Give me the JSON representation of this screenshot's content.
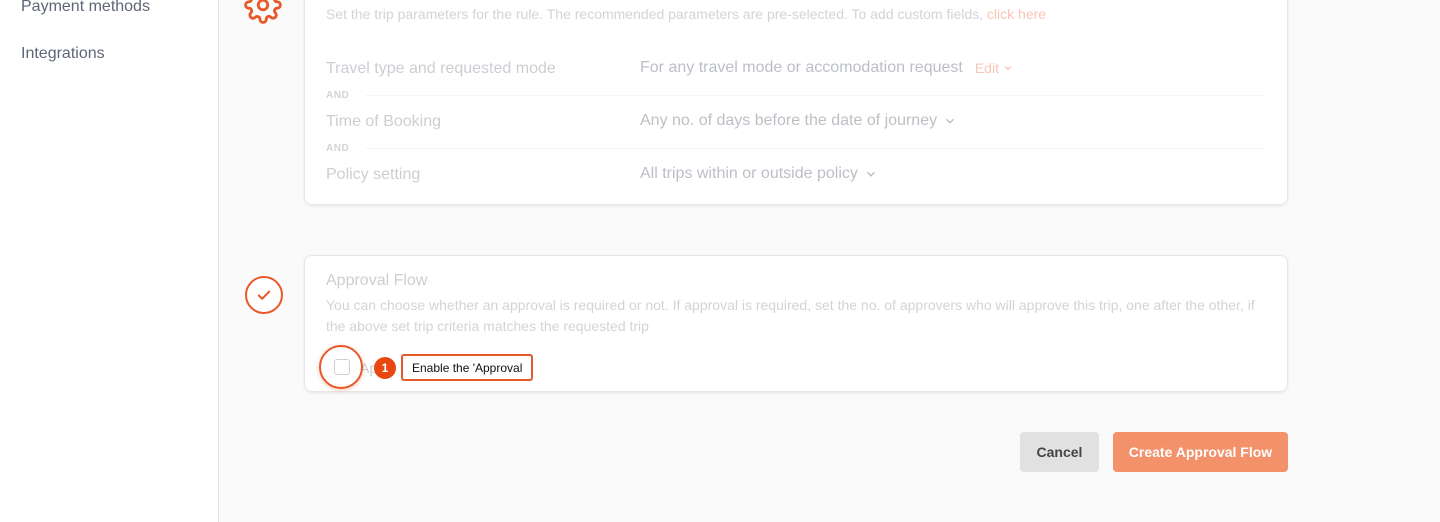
{
  "sidebar": {
    "items": [
      {
        "label": "Payment methods"
      },
      {
        "label": "Integrations"
      }
    ]
  },
  "trip_card": {
    "description": "Set the trip parameters for the rule. The recommended parameters are pre-selected. To add custom fields,",
    "link": "click here",
    "rows": [
      {
        "label": "Travel type and requested mode",
        "value": "For any travel mode or accomodation request",
        "edit": "Edit"
      },
      {
        "label": "Time of Booking",
        "value": "Any no. of days before the date of journey"
      },
      {
        "label": "Policy setting",
        "value": "All trips within or outside policy"
      }
    ],
    "connector": "AND"
  },
  "approval_card": {
    "title": "Approval Flow",
    "description": "You can choose whether an approval is required or not. If approval is required, set the no. of approvers who will approve this trip, one after the other, if the above set trip criteria matches the requested trip",
    "checkbox_label": "Ap"
  },
  "guide": {
    "step": "1",
    "tooltip": "Enable the 'Approval"
  },
  "actions": {
    "cancel": "Cancel",
    "create": "Create Approval Flow"
  },
  "colors": {
    "accent": "#e8592a",
    "link": "#f07f55",
    "create_button": "#f2916a"
  }
}
